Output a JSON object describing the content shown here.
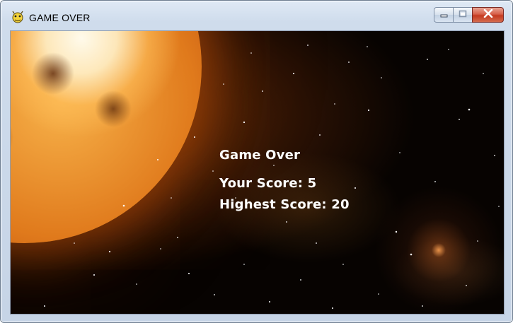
{
  "window": {
    "title": "GAME OVER",
    "controls": [
      "minimize",
      "maximize",
      "close"
    ]
  },
  "game": {
    "heading": "Game Over",
    "score_label": "Your Score: 5",
    "highest_label": "Highest Score: 20"
  },
  "icons": {
    "app": "pygame-snake-icon",
    "minimize": "minimize-icon",
    "maximize": "maximize-icon",
    "close": "close-icon"
  },
  "colors": {
    "close_button": "#c4391f",
    "text": "#ffffff",
    "space": "#070301"
  }
}
